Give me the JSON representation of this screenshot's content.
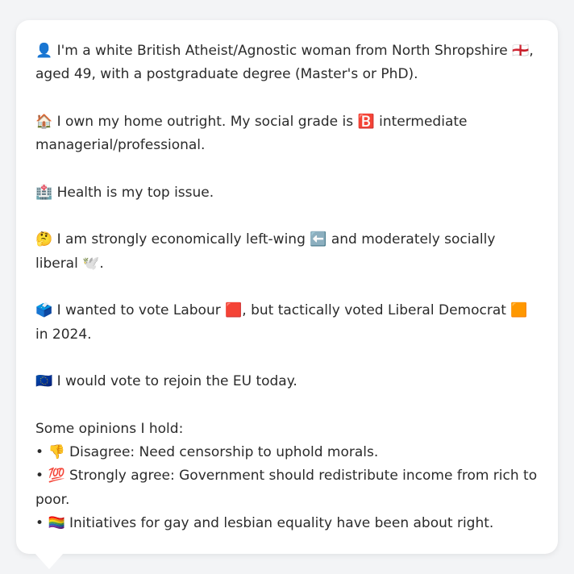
{
  "profile": {
    "identity": {
      "icon": "👤",
      "text": "I'm a white British Atheist/Agnostic woman from North Shropshire 🏴󠁧󠁢󠁥󠁮󠁧󠁿, aged 49, with a postgraduate degree (Master's or PhD)."
    },
    "home": {
      "icon": "🏠",
      "text": "I own my home outright. My social grade is 🅱️ intermediate managerial/professional."
    },
    "issue": {
      "icon": "🏥",
      "text": "Health is my top issue."
    },
    "ideology": {
      "icon": "🤔",
      "text": "I am strongly economically left-wing ⬅️ and moderately socially liberal 🕊️."
    },
    "vote": {
      "icon": "🗳️",
      "text": "I wanted to vote Labour 🟥, but tactically voted Liberal Democrat 🟧 in 2024."
    },
    "eu": {
      "icon": "🇪🇺",
      "text": "I would vote to rejoin the EU today."
    }
  },
  "opinions": {
    "heading": "Some opinions I hold:",
    "items": [
      {
        "bullet": "•",
        "icon": "👎",
        "text": "Disagree: Need censorship to uphold morals."
      },
      {
        "bullet": "•",
        "icon": "💯",
        "text": "Strongly agree: Government should redistribute income from rich to poor."
      },
      {
        "bullet": "•",
        "icon": "🏳️‍🌈",
        "text": "Initiatives for gay and lesbian equality have been about right."
      }
    ]
  }
}
